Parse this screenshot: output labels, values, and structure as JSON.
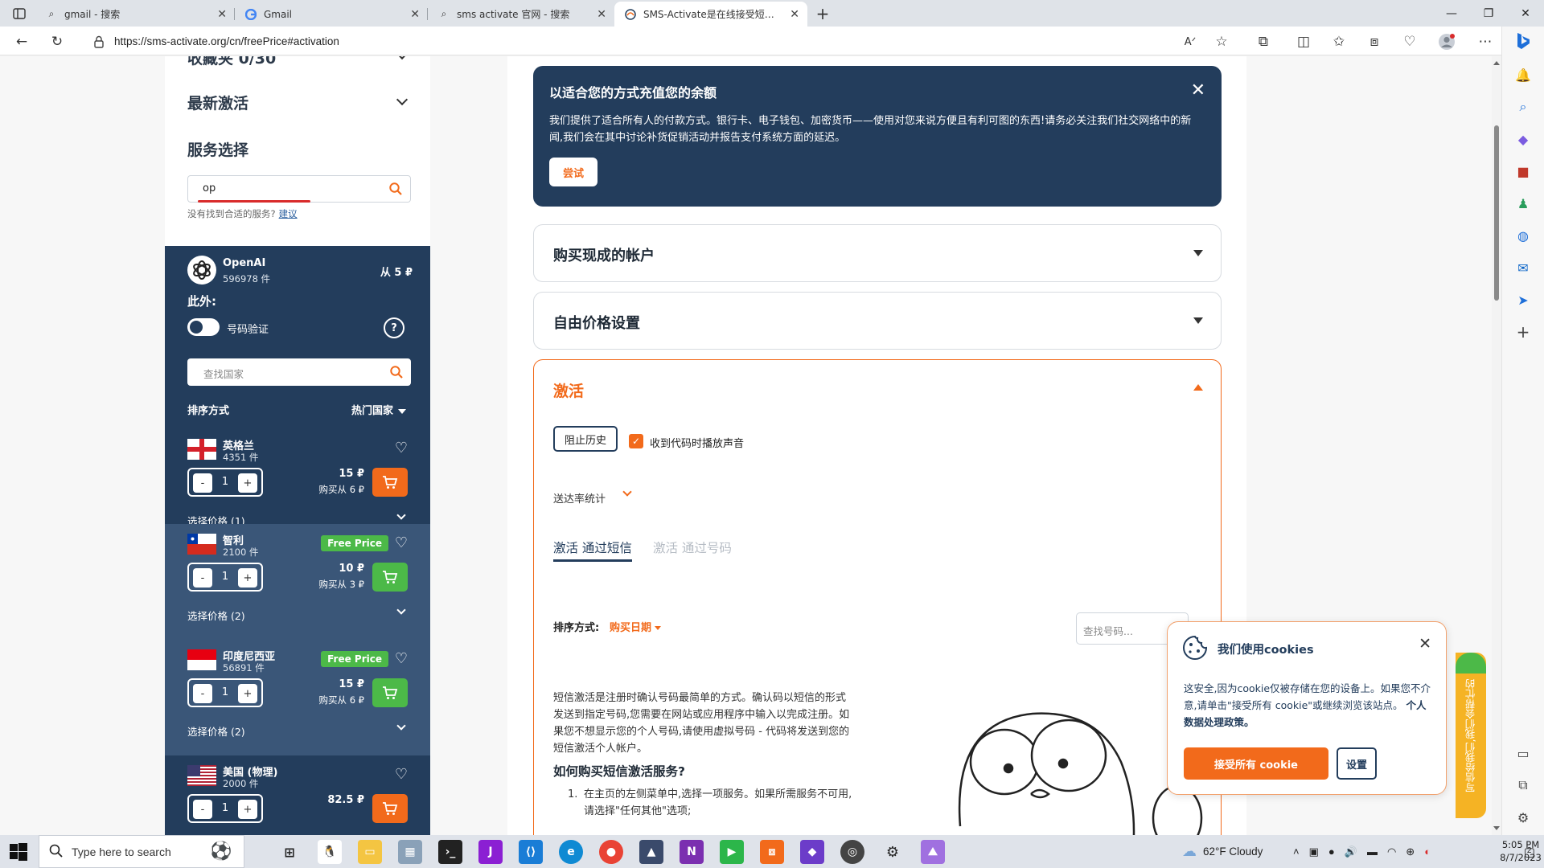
{
  "browser": {
    "tabs": [
      {
        "label": "gmail - 搜索",
        "icon": "search-icon"
      },
      {
        "label": "Gmail",
        "icon": "google-icon"
      },
      {
        "label": "sms activate 官网 - 搜索",
        "icon": "search-icon"
      },
      {
        "label": "SMS-Activate是在线接受短信的",
        "icon": "sms-activate-icon",
        "active": true
      }
    ],
    "url": "https://sms-activate.org/cn/freePrice#activation"
  },
  "sidebar": {
    "clipped_heading": "收藏夹 0/30",
    "recent": "最新激活",
    "service_heading": "服务选择",
    "search_value": "op",
    "hint": "没有找到合适的服务?",
    "hint_link": "建议",
    "service": {
      "name": "OpenAI",
      "count": "596978 件",
      "price": "从 5 ₽"
    },
    "also": "此外:",
    "toggle_label": "号码验证",
    "help": "?",
    "country_search_placeholder": "查找国家",
    "sort_label": "排序方式",
    "sort_value": "热门国家",
    "countries": [
      {
        "name": "英格兰",
        "count": "4351 件",
        "qty": "1",
        "price": "15 ₽",
        "from": "购买从 6 ₽",
        "select": "选择价格 (1)",
        "free": false
      },
      {
        "name": "智利",
        "count": "2100 件",
        "qty": "1",
        "price": "10 ₽",
        "from": "购买从 3 ₽",
        "select": "选择价格 (2)",
        "free": true
      },
      {
        "name": "印度尼西亚",
        "count": "56891 件",
        "qty": "1",
        "price": "15 ₽",
        "from": "购买从 6 ₽",
        "select": "选择价格 (2)",
        "free": true
      },
      {
        "name": "美国 (物理)",
        "count": "2000 件",
        "qty": "1",
        "price": "82.5 ₽",
        "from": "",
        "select": "",
        "free": false
      }
    ],
    "free_price_label": "Free Price",
    "minus": "-",
    "plus": "+"
  },
  "banner": {
    "title": "以适合您的方式充值您的余额",
    "text": "我们提供了适合所有人的付款方式。银行卡、电子钱包、加密货币——使用对您来说方便且有利可图的东西!请务必关注我们社交网络中的新闻,我们会在其中讨论补货促销活动并报告支付系统方面的延迟。",
    "button": "尝试"
  },
  "sections": {
    "buy_accounts": "购买现成的帐户",
    "free_price": "自由价格设置",
    "activation": "激活"
  },
  "activation": {
    "block_history": "阻止历史",
    "sound_label": "收到代码时播放声音",
    "stats": "送达率统计",
    "tab_sms": "激活 通过短信",
    "tab_number": "激活 通过号码",
    "sort_by": "排序方式:",
    "sort_value": "购买日期",
    "number_search_placeholder": "查找号码...",
    "description": "短信激活是注册时确认号码最简单的方式。确认码以短信的形式发送到指定号码,您需要在网站或应用程序中输入以完成注册。如果您不想显示您的个人号码,请使用虚拟号码 - 代码将发送到您的短信激活个人帐户。",
    "howto_title": "如何购买短信激活服务?",
    "step1_num": "1.",
    "step1": "在主页的左侧菜单中,选择一项服务。如果所需服务不可用,请选择\"任何其他\"选项;"
  },
  "cookie": {
    "title": "我们使用cookies",
    "text": "这安全,因为cookie仅被存储在您的设备上。如果您不介意,请单击\"接受所有 cookie\"或继续浏览该站点。",
    "link": "个人数据处理政策。",
    "accept": "接受所有 cookie",
    "settings": "设置"
  },
  "feedback": "写信给我们,我们会帮忙的",
  "taskbar": {
    "search_placeholder": "Type here to search",
    "weather": "62°F  Cloudy",
    "time": "5:05 PM",
    "date": "8/7/2023",
    "notifications": "2"
  },
  "colors": {
    "navy": "#233d5c",
    "orange": "#f26a1b",
    "green": "#4cb948"
  }
}
